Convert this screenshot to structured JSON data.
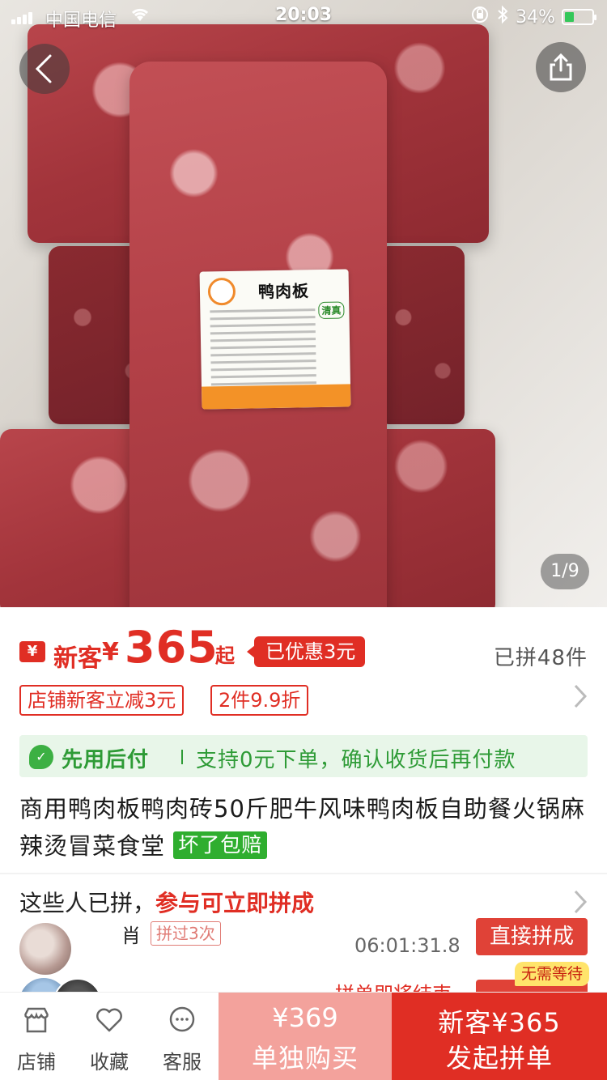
{
  "status_bar": {
    "carrier": "中国电信",
    "time": "20:03",
    "battery": "34%",
    "battery_level": 0.34
  },
  "gallery": {
    "counter": "1/9",
    "label_title": "鸭肉板",
    "label_badge": "清真"
  },
  "price": {
    "currency_badge": "¥",
    "new_customer_label": "新客",
    "currency": "¥",
    "amount": "365",
    "from": "起",
    "discount_tag": "已优惠3元",
    "sold": "已拼48件"
  },
  "coupons": [
    "店铺新客立减3元",
    "2件9.9折"
  ],
  "pay_later": {
    "title": "先用后付",
    "desc": "支持0元下单，确认收货后再付款"
  },
  "product": {
    "title": "商用鸭肉板鸭肉砖50斤肥牛风味鸭肉板自助餐火锅麻辣烫冒菜食堂",
    "guarantee": "坏了包赔"
  },
  "group_buy": {
    "heading_a": "这些人已拼，",
    "heading_b": "参与可立即拼成",
    "row1": {
      "name": "肖",
      "times": "拼过3次",
      "countdown": "06:01:31.8",
      "button": "直接拼成"
    },
    "row2": {
      "ending": "拼单即将结束",
      "no_wait": "无需等待"
    }
  },
  "bottom_bar": {
    "tabs": [
      {
        "label": "店铺",
        "icon": "store-icon"
      },
      {
        "label": "收藏",
        "icon": "heart-icon"
      },
      {
        "label": "客服",
        "icon": "chat-icon"
      }
    ],
    "buy_alone_price": "¥369",
    "buy_alone_label": "单独购买",
    "group_price": "新客¥365",
    "group_label": "发起拼单"
  },
  "colors": {
    "accent": "#e02e24",
    "green": "#2fae2f",
    "buy_alone_bg": "#f3a29c"
  }
}
